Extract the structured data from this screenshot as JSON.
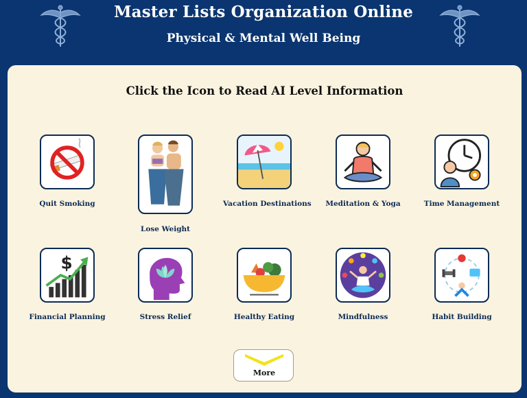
{
  "header": {
    "title": "Master Lists Organization Online",
    "subtitle": "Physical & Mental Well Being",
    "emblem_icon": "caduceus-icon"
  },
  "panel": {
    "heading": "Click the Icon to Read AI Level Information",
    "tiles": [
      {
        "label": "Quit Smoking",
        "icon": "no-smoking-icon"
      },
      {
        "label": "Lose Weight",
        "icon": "weight-loss-icon"
      },
      {
        "label": "Vacation Destinations",
        "icon": "beach-umbrella-icon"
      },
      {
        "label": "Meditation & Yoga",
        "icon": "meditation-icon"
      },
      {
        "label": "Time Management",
        "icon": "clock-gear-icon"
      },
      {
        "label": "Financial Planning",
        "icon": "dollar-growth-chart-icon"
      },
      {
        "label": "Stress Relief",
        "icon": "head-lotus-icon"
      },
      {
        "label": "Healthy Eating",
        "icon": "food-bowl-icon"
      },
      {
        "label": "Mindfulness",
        "icon": "mindfulness-icon"
      },
      {
        "label": "Habit Building",
        "icon": "habit-cycle-icon"
      }
    ],
    "more_button": {
      "label": "More",
      "icon": "chevron-down-icon"
    }
  },
  "colors": {
    "background": "#0b3570",
    "panel": "#faf3df",
    "label_text": "#0b2a55",
    "chevron": "#f2e21a"
  }
}
